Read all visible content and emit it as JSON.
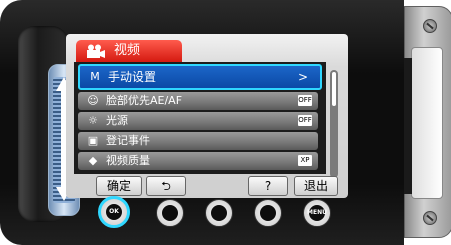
{
  "screen": {
    "tab": {
      "label": "视频"
    },
    "menu": [
      {
        "icon": "manual-setup-icon",
        "label": "手动设置",
        "chevron": ">",
        "selected": true
      },
      {
        "icon": "face-icon",
        "label": "脸部优先AE/AF",
        "badge": "OFF"
      },
      {
        "icon": "light-icon",
        "label": "光源",
        "badge": "OFF"
      },
      {
        "icon": "event-icon",
        "label": "登记事件"
      },
      {
        "icon": "quality-icon",
        "label": "视频质量",
        "badge": "XP"
      }
    ],
    "softkeys": {
      "ok": "确定",
      "back": "⮌",
      "help": "?",
      "quit": "退出"
    }
  },
  "buttons": {
    "ok": "OK",
    "menu": "MENU"
  },
  "colors": {
    "accent": "#2fd7ff",
    "tab": "#e2261b",
    "selected_row": "#0b49a6"
  }
}
